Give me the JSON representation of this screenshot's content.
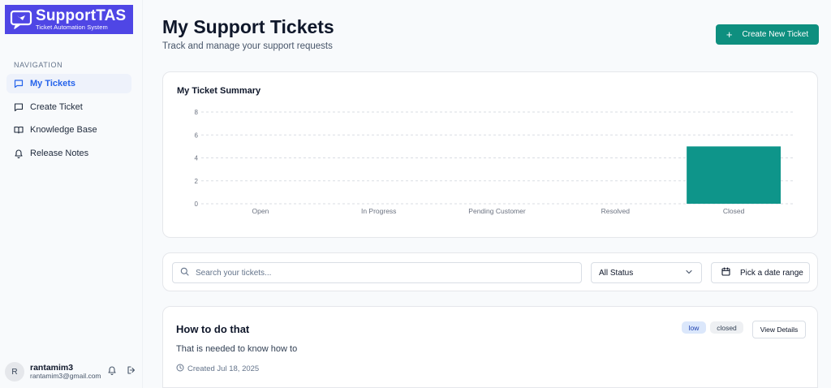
{
  "brand": {
    "name": "SupportTAS",
    "tagline": "Ticket Automation System",
    "color": "#4f46e5"
  },
  "sidebar": {
    "heading": "NAVIGATION",
    "items": [
      {
        "label": "My Tickets",
        "icon": "message-square-icon",
        "active": true
      },
      {
        "label": "Create Ticket",
        "icon": "message-square-icon",
        "active": false
      },
      {
        "label": "Knowledge Base",
        "icon": "book-open-icon",
        "active": false
      },
      {
        "label": "Release Notes",
        "icon": "bell-icon",
        "active": false
      }
    ]
  },
  "user": {
    "initial": "R",
    "name": "rantamim3",
    "email": "rantamim3@gmail.com"
  },
  "header": {
    "title": "My Support Tickets",
    "subtitle": "Track and manage your support requests",
    "create_label": "Create New Ticket",
    "accent": "#0e8f7f"
  },
  "summary": {
    "title": "My Ticket Summary"
  },
  "chart_data": {
    "type": "bar",
    "categories": [
      "Open",
      "In Progress",
      "Pending Customer",
      "Resolved",
      "Closed"
    ],
    "values": [
      0,
      0,
      0,
      0,
      5
    ],
    "ylim": [
      0,
      8
    ],
    "yticks": [
      "0",
      "2",
      "4",
      "6",
      "8"
    ],
    "grid": true,
    "bar_color": "#0e958a"
  },
  "filters": {
    "search_placeholder": "Search your tickets...",
    "status_value": "All Status",
    "date_label": "Pick a date range"
  },
  "tickets": [
    {
      "title": "How to do that",
      "description": "That is needed to know how to",
      "created": "Created Jul 18, 2025",
      "priority": "low",
      "status": "closed",
      "view_label": "View Details"
    }
  ]
}
